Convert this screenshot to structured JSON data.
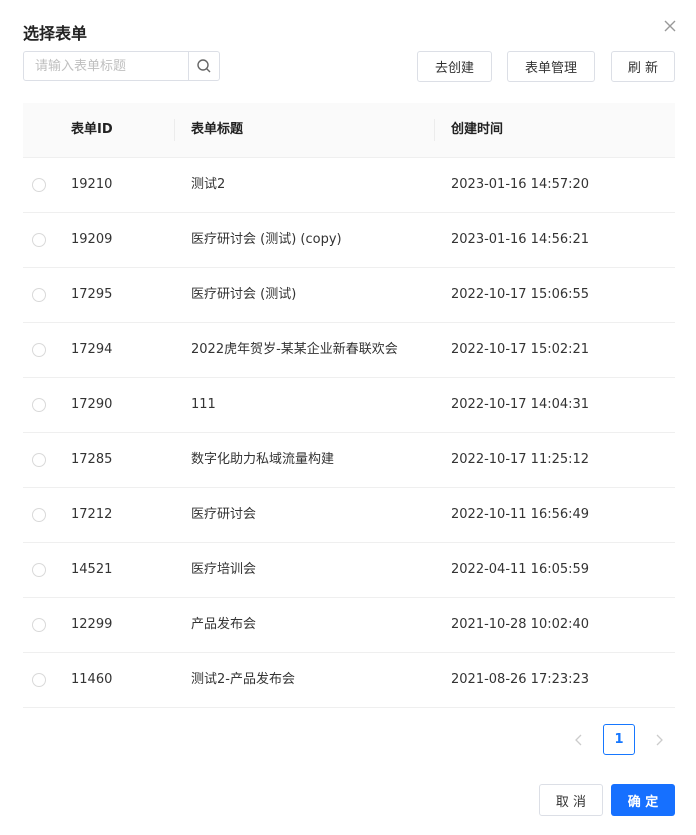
{
  "dialog": {
    "title": "选择表单"
  },
  "search": {
    "placeholder": "请输入表单标题",
    "value": ""
  },
  "toolbar": {
    "create_label": "去创建",
    "manage_label": "表单管理",
    "refresh_label": "刷 新"
  },
  "table": {
    "headers": {
      "id": "表单ID",
      "title": "表单标题",
      "created": "创建时间"
    },
    "rows": [
      {
        "id": "19210",
        "title": "测试2",
        "created": "2023-01-16 14:57:20"
      },
      {
        "id": "19209",
        "title": "医疗研讨会 (测试) (copy)",
        "created": "2023-01-16 14:56:21"
      },
      {
        "id": "17295",
        "title": "医疗研讨会 (测试)",
        "created": "2022-10-17 15:06:55"
      },
      {
        "id": "17294",
        "title": "2022虎年贺岁-某某企业新春联欢会",
        "created": "2022-10-17 15:02:21"
      },
      {
        "id": "17290",
        "title": "111",
        "created": "2022-10-17 14:04:31"
      },
      {
        "id": "17285",
        "title": "数字化助力私域流量构建",
        "created": "2022-10-17 11:25:12"
      },
      {
        "id": "17212",
        "title": "医疗研讨会",
        "created": "2022-10-11 16:56:49"
      },
      {
        "id": "14521",
        "title": "医疗培训会",
        "created": "2022-04-11 16:05:59"
      },
      {
        "id": "12299",
        "title": "产品发布会",
        "created": "2021-10-28 10:02:40"
      },
      {
        "id": "11460",
        "title": "测试2-产品发布会",
        "created": "2021-08-26 17:23:23"
      }
    ]
  },
  "pagination": {
    "current_page": "1"
  },
  "footer": {
    "cancel_label": "取 消",
    "ok_label": "确 定"
  },
  "colors": {
    "primary": "#1670ff",
    "border": "#dcdfe6",
    "header_bg": "#fafafa"
  },
  "icons": {
    "close": "close-icon",
    "search": "search-icon",
    "prev": "chevron-left-icon",
    "next": "chevron-right-icon"
  }
}
